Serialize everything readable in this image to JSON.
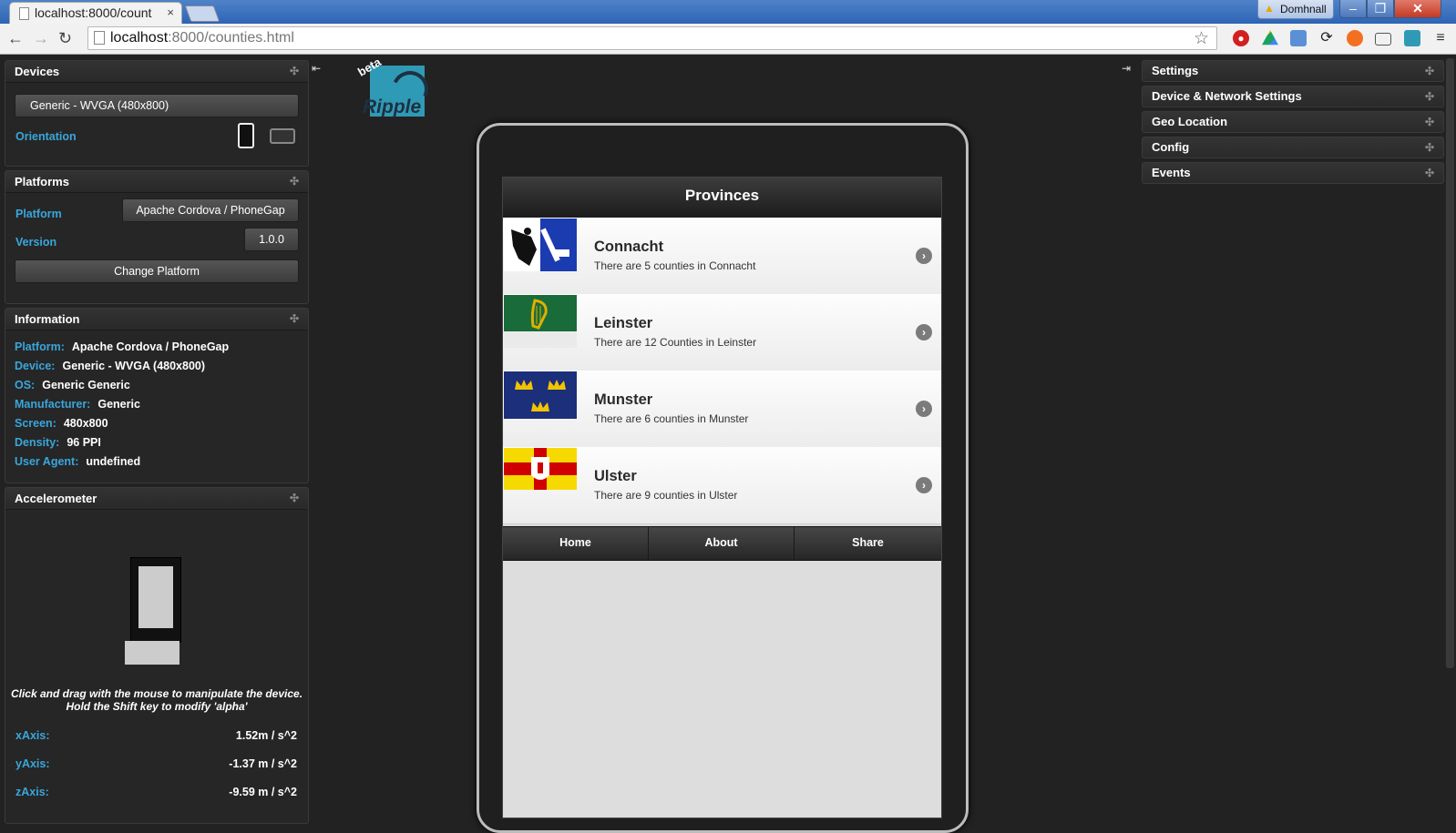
{
  "browser": {
    "tab_title": "localhost:8000/count",
    "tab_close": "×",
    "user_name": "Domhnall",
    "url_host": "localhost",
    "url_path": ":8000/counties.html",
    "win_min": "‒",
    "win_max": "❐",
    "win_close": "✕"
  },
  "devices": {
    "title": "Devices",
    "device_selected": "Generic - WVGA (480x800)",
    "orientation_label": "Orientation"
  },
  "platforms": {
    "title": "Platforms",
    "platform_label": "Platform",
    "platform_value": "Apache Cordova / PhoneGap",
    "version_label": "Version",
    "version_value": "1.0.0",
    "change_button": "Change Platform"
  },
  "information": {
    "title": "Information",
    "rows": [
      {
        "k": "Platform:",
        "v": "Apache Cordova / PhoneGap"
      },
      {
        "k": "Device:",
        "v": "Generic - WVGA (480x800)"
      },
      {
        "k": "OS:",
        "v": "Generic Generic"
      },
      {
        "k": "Manufacturer:",
        "v": "Generic"
      },
      {
        "k": "Screen:",
        "v": "480x800"
      },
      {
        "k": "Density:",
        "v": "96 PPI"
      },
      {
        "k": "User Agent:",
        "v": "undefined"
      }
    ]
  },
  "accelerometer": {
    "title": "Accelerometer",
    "hint_line1": "Click and drag with the mouse to manipulate the device.",
    "hint_line2": "Hold the Shift key to modify 'alpha'",
    "x_label": "xAxis:",
    "x_value": "1.52m / s^2",
    "y_label": "yAxis:",
    "y_value": "-1.37 m / s^2",
    "z_label": "zAxis:",
    "z_value": "-9.59 m / s^2"
  },
  "logo": {
    "beta": "beta",
    "name": "Ripple"
  },
  "app": {
    "header": "Provinces",
    "provinces": [
      {
        "name": "Connacht",
        "desc": "There are 5 counties in Connacht"
      },
      {
        "name": "Leinster",
        "desc": "There are 12 Counties in Leinster"
      },
      {
        "name": "Munster",
        "desc": "There are 6 counties in Munster"
      },
      {
        "name": "Ulster",
        "desc": "There are 9 counties in Ulster"
      }
    ],
    "nav": [
      "Home",
      "About",
      "Share"
    ]
  },
  "right_panels": [
    "Settings",
    "Device & Network Settings",
    "Geo Location",
    "Config",
    "Events"
  ],
  "colors": {
    "accent": "#39a6dc",
    "background": "#222222",
    "ripple_teal": "#2f9ab6"
  }
}
